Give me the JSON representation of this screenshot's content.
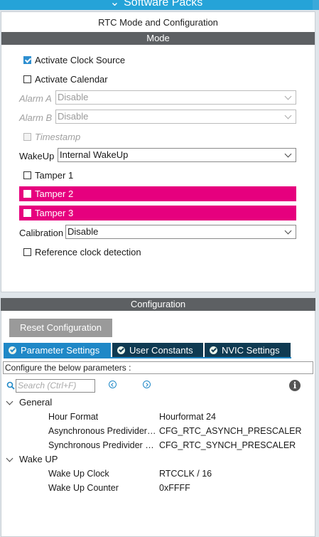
{
  "top_bar": {
    "title": "Software Packs"
  },
  "mode_panel": {
    "title": "RTC Mode and Configuration",
    "section_label": "Mode",
    "activate_clock_source": {
      "label": "Activate Clock Source",
      "checked": true
    },
    "activate_calendar": {
      "label": "Activate Calendar",
      "checked": false
    },
    "alarm_a": {
      "label": "Alarm A",
      "value": "Disable",
      "enabled": false
    },
    "alarm_b": {
      "label": "Alarm B",
      "value": "Disable",
      "enabled": false
    },
    "timestamp": {
      "label": "Timestamp",
      "enabled": false
    },
    "wakeup": {
      "label": "WakeUp",
      "value": "Internal WakeUp"
    },
    "tamper1": {
      "label": "Tamper 1",
      "checked": false
    },
    "tamper2": {
      "label": "Tamper 2",
      "checked": false,
      "highlight": "#e6007e"
    },
    "tamper3": {
      "label": "Tamper 3",
      "checked": false,
      "highlight": "#e6007e"
    },
    "calibration": {
      "label": "Calibration",
      "value": "Disable"
    },
    "ref_clock": {
      "label": "Reference clock detection",
      "checked": false
    }
  },
  "config_panel": {
    "section_label": "Configuration",
    "reset_button": "Reset Configuration",
    "tabs": [
      {
        "label": "Parameter Settings",
        "active": true
      },
      {
        "label": "User Constants",
        "active": false
      },
      {
        "label": "NVIC Settings",
        "active": false
      }
    ],
    "instructions": "Configure the below parameters :",
    "search_placeholder": "Search (Ctrl+F)",
    "groups": [
      {
        "name": "General",
        "expanded": true,
        "params": [
          {
            "name": "Hour Format",
            "value": "Hourformat 24"
          },
          {
            "name": "Asynchronous Predivider value",
            "value": "CFG_RTC_ASYNCH_PRESCALER"
          },
          {
            "name": "Synchronous Predivider value",
            "value": "CFG_RTC_SYNCH_PRESCALER"
          }
        ]
      },
      {
        "name": "Wake UP",
        "expanded": true,
        "params": [
          {
            "name": "Wake Up Clock",
            "value": "RTCCLK / 16"
          },
          {
            "name": "Wake Up Counter",
            "value": "0xFFFF"
          }
        ]
      }
    ]
  },
  "colors": {
    "accent": "#1f88c7",
    "tab_dark": "#0f3a52",
    "section_bar": "#5d6063",
    "top_bar": "#25a3d8"
  }
}
